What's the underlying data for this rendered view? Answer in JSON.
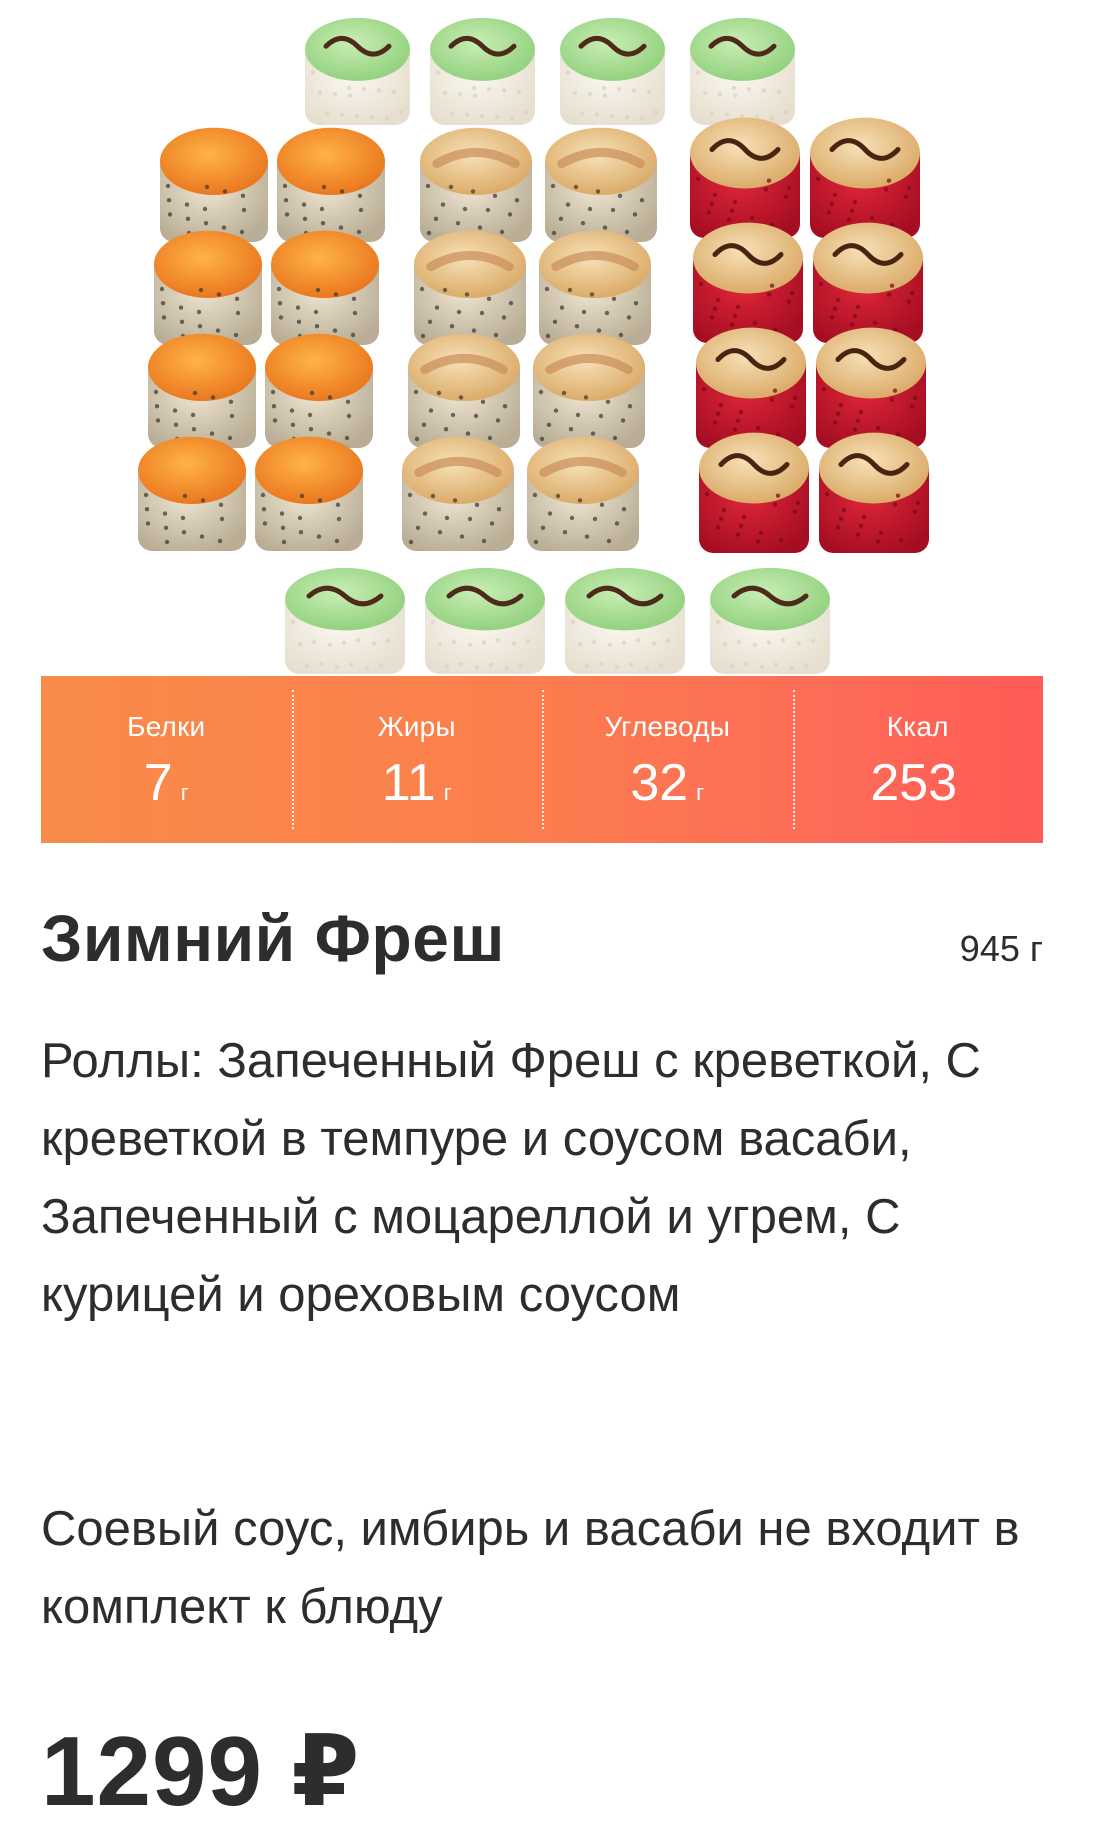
{
  "product": {
    "image_alt": "Set of sushi rolls",
    "nutrition": [
      {
        "label": "Белки",
        "value": "7",
        "unit": "г"
      },
      {
        "label": "Жиры",
        "value": "11",
        "unit": "г"
      },
      {
        "label": "Углеводы",
        "value": "32",
        "unit": "г"
      },
      {
        "label": "Ккал",
        "value": "253",
        "unit": ""
      }
    ],
    "title": "Зимний Фреш",
    "weight": "945 г",
    "description": "Роллы: Запеченный Фреш с креветкой, С креветкой в темпуре и соусом васаби, Запеченный с моцареллой и угрем, С курицей и ореховым соусом",
    "note": "Соевый соус, имбирь и васаби не входит в комплект к блюду",
    "price": "1299 ₽"
  },
  "colors": {
    "banner_start": "#f88b49",
    "banner_end": "#fe5a56",
    "text": "#2d2d2d",
    "background": "#ffffff"
  }
}
